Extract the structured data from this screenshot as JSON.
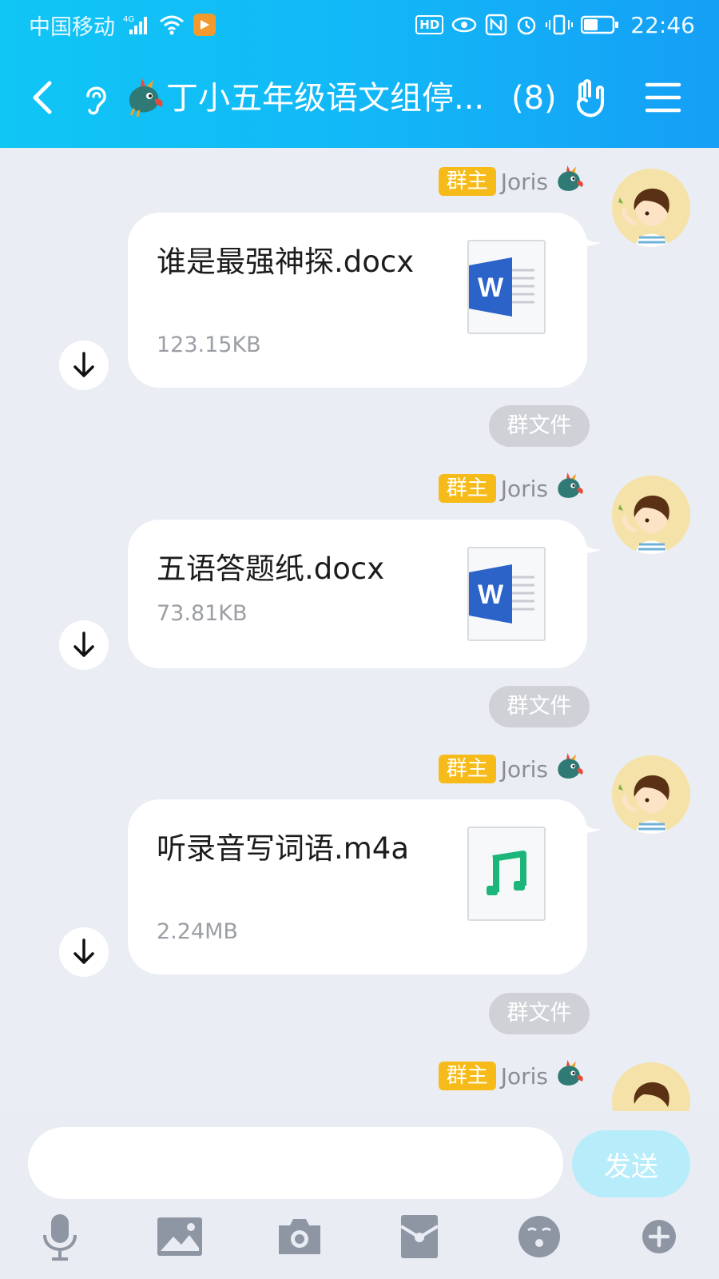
{
  "status_bar": {
    "carrier": "中国移动",
    "network": "4G",
    "hd_label": "HD",
    "time": "22:46"
  },
  "nav": {
    "title": "丁小五年级语文组停...",
    "member_count": "(8)"
  },
  "messages": [
    {
      "sender_badge": "群主",
      "sender_name": "Joris",
      "file_name": "谁是最强神探.docx",
      "file_size": "123.15KB",
      "file_type": "word-document-icon",
      "tag": "群文件"
    },
    {
      "sender_badge": "群主",
      "sender_name": "Joris",
      "file_name": "五语答题纸.docx",
      "file_size": "73.81KB",
      "file_type": "word-document-icon",
      "tag": "群文件"
    },
    {
      "sender_badge": "群主",
      "sender_name": "Joris",
      "file_name": "听录音写词语.m4a",
      "file_size": "2.24MB",
      "file_type": "music-file-icon",
      "tag": "群文件"
    },
    {
      "sender_badge": "群主",
      "sender_name": "Joris"
    }
  ],
  "input": {
    "placeholder": "",
    "send_label": "发送"
  },
  "toolbar": [
    "microphone-icon",
    "image-icon",
    "camera-icon",
    "red-packet-icon",
    "emoji-icon",
    "plus-icon"
  ],
  "colors": {
    "header_start": "#10c6f5",
    "header_end": "#159ff6",
    "owner_badge": "#f7bb19",
    "chat_bg": "#ebedf4",
    "word_blue": "#2b63c9",
    "music_green": "#1db67a",
    "send_disabled": "#b7ecfb"
  }
}
